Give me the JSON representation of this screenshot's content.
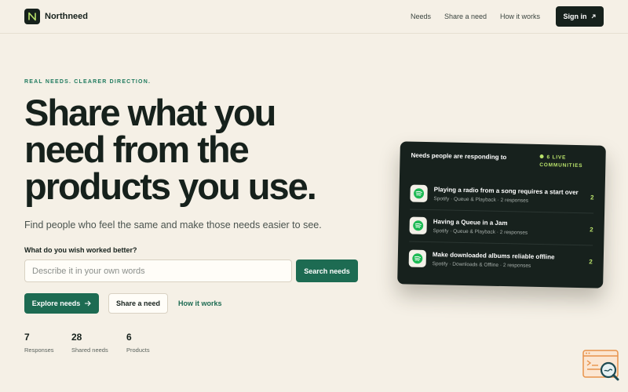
{
  "header": {
    "brand": "Northneed",
    "nav": [
      {
        "label": "Needs"
      },
      {
        "label": "Share a need"
      },
      {
        "label": "How it works"
      }
    ],
    "signin_label": "Sign in",
    "signin_icon": "arrow-up-right-icon"
  },
  "hero": {
    "eyebrow": "REAL NEEDS. CLEARER DIRECTION.",
    "headline": "Share what you need from the products you use.",
    "subtitle": "Find people who feel the same and make those needs easier to see.",
    "question_label": "What do you wish worked better?",
    "search_placeholder": "Describe it in your own words",
    "search_value": "",
    "search_button": "Search needs",
    "explore_button": "Explore needs",
    "share_button": "Share a need",
    "how_link": "How it works"
  },
  "stats": [
    {
      "value": "7",
      "label": "Responses"
    },
    {
      "value": "28",
      "label": "Shared needs"
    },
    {
      "value": "6",
      "label": "Products"
    }
  ],
  "card": {
    "title": "Needs people are responding to",
    "live_badge": "6 LIVE COMMUNITIES",
    "items": [
      {
        "title": "Playing a radio from a song requires a start over",
        "meta": "Spotify · Queue & Playback · 2 responses",
        "count": "2",
        "icon": "spotify-icon"
      },
      {
        "title": "Having a Queue in a Jam",
        "meta": "Spotify · Queue & Playback · 2 responses",
        "count": "2",
        "icon": "spotify-icon"
      },
      {
        "title": "Make downloaded albums reliable offline",
        "meta": "Spotify · Downloads & Offline · 2 responses",
        "count": "2",
        "icon": "spotify-icon"
      }
    ]
  },
  "colors": {
    "background": "#f5f0e6",
    "ink": "#16211c",
    "accent_green": "#1d6b52",
    "live_green": "#b9e26b",
    "spotify_green": "#1db954"
  }
}
